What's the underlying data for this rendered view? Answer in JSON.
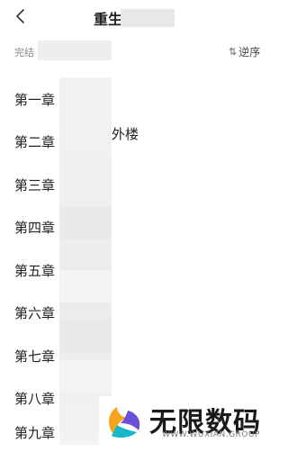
{
  "header": {
    "title_start": "重生",
    "title_end": "",
    "back_icon": "chevron-left-icon"
  },
  "subbar": {
    "status": "完结",
    "sort_label": "逆序",
    "sort_icon": "sort-icon"
  },
  "chapters": [
    {
      "label": "第一章"
    },
    {
      "label": "第二章",
      "visible_fragment": "外楼"
    },
    {
      "label": "第三章"
    },
    {
      "label": "第四章"
    },
    {
      "label": "第五章"
    },
    {
      "label": "第六章"
    },
    {
      "label": "第七章"
    },
    {
      "label": "第八章"
    },
    {
      "label": "第九章"
    }
  ],
  "watermark": {
    "brand_text": "无限数码",
    "url": "WWW.WUXIAN.GROUP",
    "colors": {
      "orange": "#f7a21b",
      "purple": "#6b4fd8",
      "teal": "#19b5c9"
    }
  }
}
